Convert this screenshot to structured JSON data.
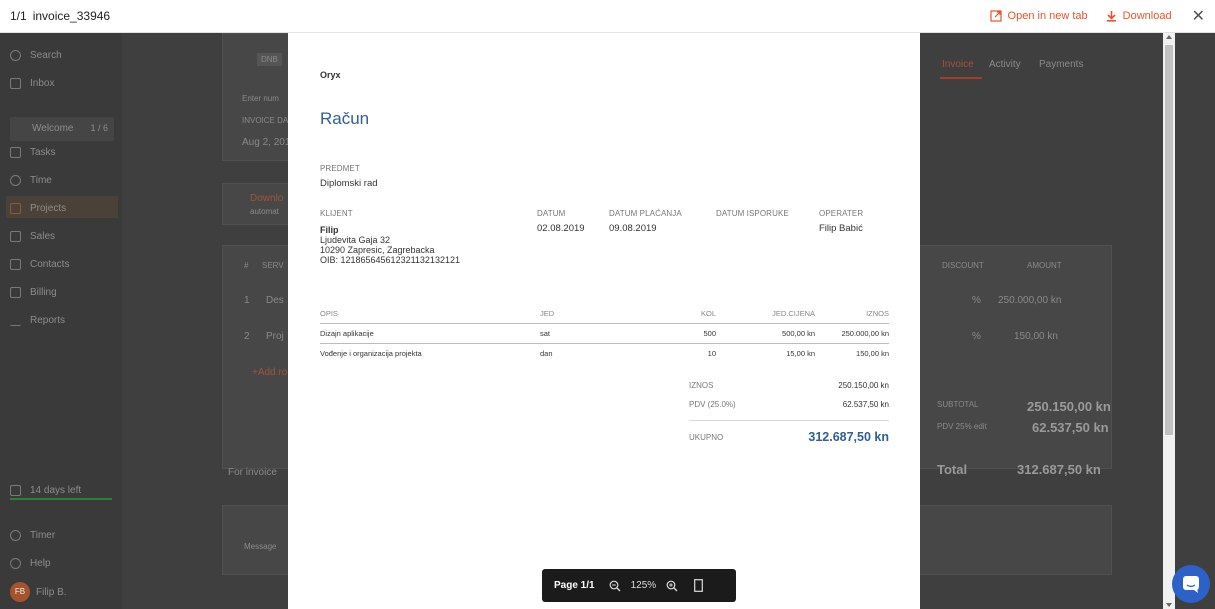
{
  "viewer": {
    "counter": "1/1",
    "filename": "invoice_33946",
    "open_new_tab": "Open in new tab",
    "download": "Download",
    "close_glyph": "✕"
  },
  "colors": {
    "accent": "#e8542a",
    "doc_blue": "#2f5f95",
    "toolbar_bg": "#1b1b1b",
    "chat_blue": "#2c62c8"
  },
  "background_app": {
    "sidebar": {
      "items": [
        "Search",
        "Inbox",
        "Welcome",
        "Tasks",
        "Time",
        "Projects",
        "Sales",
        "Contacts",
        "Billing",
        "Reports"
      ],
      "welcome_count": "1 / 6",
      "trial": "14 days left",
      "bottom_items": [
        "Timer",
        "Help"
      ],
      "avatar_initials": "FB",
      "user_name": "Filip B."
    },
    "tabs": [
      "Invoice",
      "Activity",
      "Payments"
    ],
    "fragments": {
      "dnb": "DNB",
      "enter_num": "Enter num",
      "invoice_date": "INVOICE DAT",
      "date": "Aug 2, 201",
      "download": "Downlo",
      "download_sub": "automat",
      "col_num": "#",
      "col_serv": "SERV",
      "row1_num": "1",
      "row1": "Des",
      "row2_num": "2",
      "row2": "Proj",
      "add_row": "+Add ro",
      "for_invoice": "For invoice",
      "message": "Message",
      "col_discount": "DISCOUNT",
      "col_amount": "AMOUNT",
      "row1_pct": "%",
      "row1_amount": "250.000,00 kn",
      "row2_pct": "%",
      "row2_amount": "150,00 kn",
      "subtotal_label": "SUBTOTAL",
      "subtotal": "250.150,00 kn",
      "pdv_label": "PDV 25% edit",
      "pdv": "62.537,50 kn",
      "total_label": "Total",
      "total": "312.687,50 kn"
    }
  },
  "document": {
    "company": "Oryx",
    "title": "Račun",
    "subject_label": "PREDMET",
    "subject": "Diplomski rad",
    "client_label": "KLIJENT",
    "client_name": "Filip",
    "client_address_1": "Ljudevita Gaja 32",
    "client_address_2": "10290 Zapresic, Zagrebacka",
    "client_oib": "OIB: 12186564561232113213212​1",
    "date_label": "DATUM",
    "date": "02.08.2019",
    "pay_date_label": "DATUM PLAĆANJA",
    "pay_date": "09.08.2019",
    "delivery_label": "DATUM ISPORUKE",
    "operator_label": "OPERATER",
    "operator": "Filip Babić",
    "table": {
      "headers": [
        "OPIS",
        "JED",
        "KOL",
        "JED.CIJENA",
        "IZNOS"
      ],
      "rows": [
        [
          "Dizajn aplikacije",
          "sat",
          "500",
          "500,00 kn",
          "250.000,00 kn"
        ],
        [
          "Vođenje i organizacija projekta",
          "dan",
          "10",
          "15,00 kn",
          "150,00 kn"
        ]
      ]
    },
    "summary": {
      "amount_label": "IZNOS",
      "amount": "250.150,00 kn",
      "vat_label": "PDV (25.0%)",
      "vat": "62.537,50 kn",
      "total_label": "UKUPNO",
      "total": "312.687,50 kn"
    }
  },
  "pager": {
    "page": "Page 1/1",
    "zoom": "125%"
  }
}
